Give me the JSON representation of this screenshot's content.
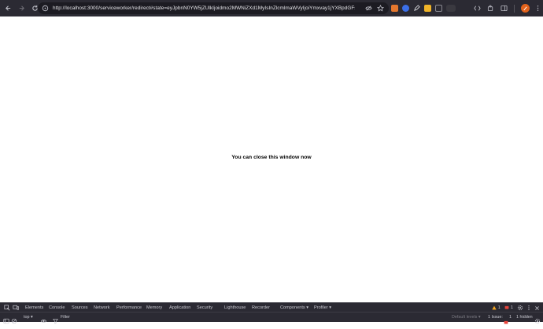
{
  "browser": {
    "url": "http://localhost:3000/serviceworker/redirect#state=eyJpbnN0YW5jZUlkIjoidmo2MWNiZXd1MyIsInZlcmlmaWVyIjoiYmxvay1jYXBpdGFsIiwiZU9..."
  },
  "page": {
    "message": "You can close this window now"
  },
  "devtools": {
    "tabs": [
      "Elements",
      "Console",
      "Sources",
      "Network",
      "Performance",
      "Memory",
      "Application",
      "Security",
      "Lighthouse",
      "Recorder",
      "Components ▾",
      "Profiler ▾"
    ],
    "issues_warning_count": "1",
    "issues_error_count": "1",
    "context_label": "top ▾",
    "filter_placeholder": "Filter",
    "levels_label": "Default levels ▾",
    "issue_summary": "1 Issue:",
    "issue_summary_count": "1",
    "hidden_count": "1 hidden"
  },
  "colors": {
    "toolbar_bg": "#2b2a33",
    "omnibox_bg": "#1c1b22",
    "warning": "#f5a623",
    "error": "#e8453c",
    "profile": "#e2631c"
  }
}
